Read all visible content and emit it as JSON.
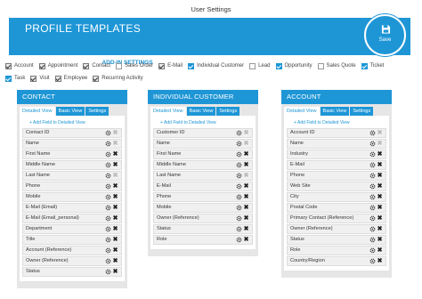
{
  "window": {
    "title": "User Settings"
  },
  "banner": {
    "title": "PROFILE TEMPLATES",
    "sync_label": "SYNC SETTINGS",
    "addin_label": "ADD-IN SETTINGS",
    "save_label": "Save",
    "color": "#1e96d6"
  },
  "entities": {
    "row1": [
      {
        "label": "Account",
        "checked": true,
        "style": "gray"
      },
      {
        "label": "Appointment",
        "checked": true,
        "style": "gray"
      },
      {
        "label": "Contact",
        "checked": true,
        "style": "gray"
      },
      {
        "label": "Sales Order",
        "checked": false,
        "style": "gray"
      },
      {
        "label": "E-Mail",
        "checked": true,
        "style": "gray"
      },
      {
        "label": "Individual Customer",
        "checked": true,
        "style": "blue"
      },
      {
        "label": "Lead",
        "checked": false,
        "style": "gray"
      },
      {
        "label": "Opportunity",
        "checked": true,
        "style": "blue"
      },
      {
        "label": "Sales Quote",
        "checked": false,
        "style": "gray"
      },
      {
        "label": "Ticket",
        "checked": true,
        "style": "blue"
      }
    ],
    "row2": [
      {
        "label": "Task",
        "checked": true,
        "style": "blue"
      },
      {
        "label": "Visit",
        "checked": true,
        "style": "gray"
      },
      {
        "label": "Employee",
        "checked": true,
        "style": "gray"
      },
      {
        "label": "Recurring Activity",
        "checked": true,
        "style": "gray"
      }
    ]
  },
  "panels": [
    {
      "title": "CONTACT",
      "tabs": [
        "Detailed View",
        "Basic View",
        "Settings"
      ],
      "add_link": "+ Add Field to Detailed View",
      "fields": [
        {
          "label": "Contact ID",
          "removable": false
        },
        {
          "label": "Name",
          "removable": false
        },
        {
          "label": "First Name",
          "removable": true
        },
        {
          "label": "Middle Name",
          "removable": true
        },
        {
          "label": "Last Name",
          "removable": false
        },
        {
          "label": "Phone",
          "removable": true
        },
        {
          "label": "Mobile",
          "removable": true
        },
        {
          "label": "E-Mail (Email)",
          "removable": true
        },
        {
          "label": "E-Mail (Email_personal)",
          "removable": true
        },
        {
          "label": "Department",
          "removable": true
        },
        {
          "label": "Title",
          "removable": true
        },
        {
          "label": "Account (Reference)",
          "removable": true
        },
        {
          "label": "Owner (Reference)",
          "removable": true
        },
        {
          "label": "Status",
          "removable": true
        }
      ]
    },
    {
      "title": "INDIVIDUAL CUSTOMER",
      "tabs": [
        "Detailed View",
        "Basic View",
        "Settings"
      ],
      "add_link": "+ Add Field to Detailed View",
      "fields": [
        {
          "label": "Customer ID",
          "removable": false
        },
        {
          "label": "Name",
          "removable": false
        },
        {
          "label": "First Name",
          "removable": true
        },
        {
          "label": "Middle Name",
          "removable": true
        },
        {
          "label": "Last Name",
          "removable": false
        },
        {
          "label": "E-Mail",
          "removable": true
        },
        {
          "label": "Phone",
          "removable": true
        },
        {
          "label": "Mobile",
          "removable": true
        },
        {
          "label": "Owner (Reference)",
          "removable": true
        },
        {
          "label": "Status",
          "removable": true
        },
        {
          "label": "Role",
          "removable": true
        }
      ]
    },
    {
      "title": "ACCOUNT",
      "tabs": [
        "Detailed View",
        "Basic View",
        "Settings"
      ],
      "add_link": "+ Add Field to Detailed View",
      "fields": [
        {
          "label": "Account ID",
          "removable": false
        },
        {
          "label": "Name",
          "removable": false
        },
        {
          "label": "Industry",
          "removable": true
        },
        {
          "label": "E-Mail",
          "removable": true
        },
        {
          "label": "Phone",
          "removable": true
        },
        {
          "label": "Web Site",
          "removable": true
        },
        {
          "label": "City",
          "removable": true
        },
        {
          "label": "Postal Code",
          "removable": true
        },
        {
          "label": "Primary Contact (Reference)",
          "removable": true
        },
        {
          "label": "Owner (Reference)",
          "removable": true
        },
        {
          "label": "Status",
          "removable": true
        },
        {
          "label": "Role",
          "removable": true
        },
        {
          "label": "Country/Region",
          "removable": true
        }
      ]
    }
  ]
}
